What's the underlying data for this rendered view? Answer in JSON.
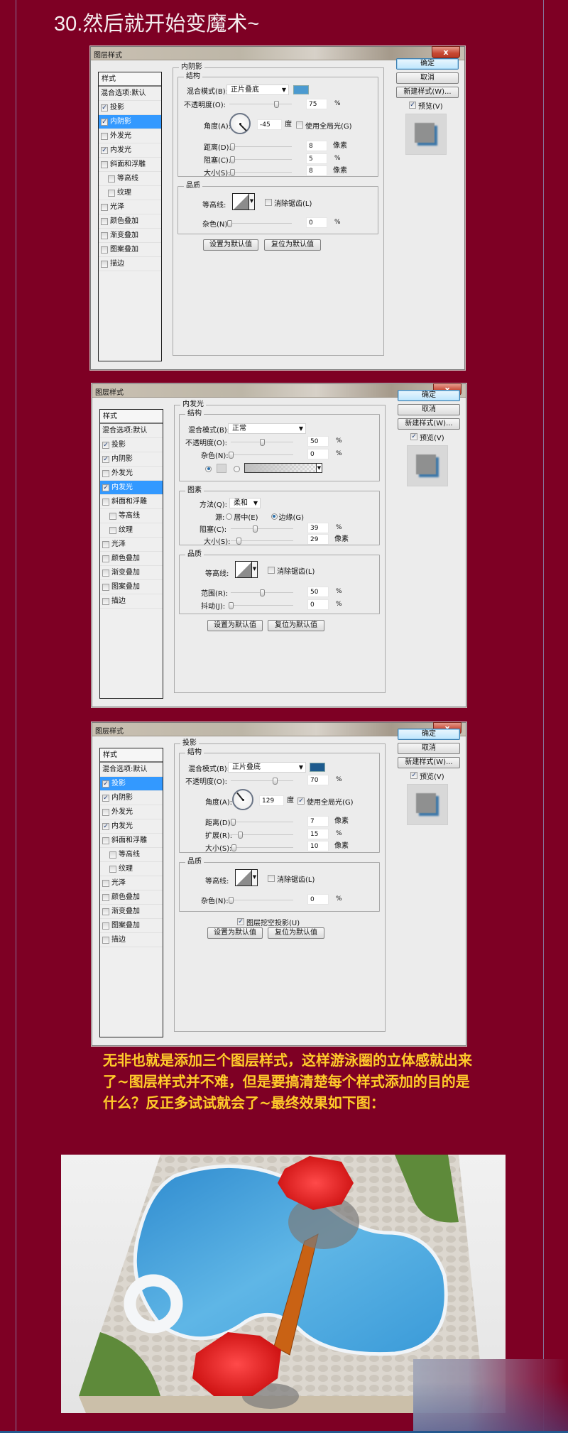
{
  "page": {
    "title": "30.然后就开始变魔术~",
    "note": "无非也就是添加三个图层样式，这样游泳圈的立体感就出来了~图层样式并不难，但是要搞清楚每个样式添加的目的是什么？反正多试试就会了~最终效果如下图：",
    "colors": {
      "background": "#7e0024",
      "note_text": "#ffcb2a",
      "selection": "#3399ff"
    }
  },
  "final_image": {
    "alt": "最终效果：游泳池俯视场景（游泳圈、红色遮阳伞、木桥、草地）"
  },
  "dialog_common": {
    "window_title": "图层样式",
    "close_label": "x",
    "styles_header": "样式",
    "blend_options": "混合选项:默认",
    "ok_label": "确定",
    "cancel_label": "取消",
    "new_style_label": "新建样式(W)...",
    "preview_label": "预览(V)",
    "set_default_label": "设置为默认值",
    "reset_default_label": "复位为默认值",
    "structure_legend": "结构",
    "quality_legend": "品质",
    "elements_legend": "图素",
    "blend_mode_label": "混合模式(B):",
    "opacity_label": "不透明度(O):",
    "angle_label": "角度(A):",
    "degree_unit": "度",
    "global_light_label": "使用全局光(G)",
    "distance_label": "距离(D):",
    "choke_label": "阻塞(C):",
    "spread_label": "扩展(R):",
    "size_label": "大小(S):",
    "contour_label": "等高线:",
    "anti_alias_label": "消除锯齿(L)",
    "noise_label": "杂色(N):",
    "technique_label": "方法(Q):",
    "source_label": "源:",
    "center_label": "居中(E)",
    "edge_label": "边缘(G)",
    "range_label": "范围(R):",
    "jitter_label": "抖动(J):",
    "knockout_label": "图层挖空投影(U)",
    "unit_percent": "%",
    "unit_px": "像素",
    "preview_checked": true
  },
  "dialogs": [
    {
      "section": "内阴影",
      "styles": [
        {
          "label": "投影",
          "checked": true,
          "indent": false,
          "selected": false
        },
        {
          "label": "内阴影",
          "checked": true,
          "indent": false,
          "selected": true
        },
        {
          "label": "外发光",
          "checked": false,
          "indent": false,
          "selected": false
        },
        {
          "label": "内发光",
          "checked": true,
          "indent": false,
          "selected": false
        },
        {
          "label": "斜面和浮雕",
          "checked": false,
          "indent": false,
          "selected": false
        },
        {
          "label": "等高线",
          "checked": false,
          "indent": true,
          "selected": false
        },
        {
          "label": "纹理",
          "checked": false,
          "indent": true,
          "selected": false
        },
        {
          "label": "光泽",
          "checked": false,
          "indent": false,
          "selected": false
        },
        {
          "label": "颜色叠加",
          "checked": false,
          "indent": false,
          "selected": false
        },
        {
          "label": "渐变叠加",
          "checked": false,
          "indent": false,
          "selected": false
        },
        {
          "label": "图案叠加",
          "checked": false,
          "indent": false,
          "selected": false
        },
        {
          "label": "描边",
          "checked": false,
          "indent": false,
          "selected": false
        }
      ],
      "blend_mode": "正片叠底",
      "color": "#4b9ad0",
      "opacity": "75",
      "angle": "-45",
      "use_global_light": false,
      "distance": "8",
      "choke": "5",
      "size": "8",
      "anti_alias": false,
      "noise": "0",
      "slider_fraction": {
        "opacity": 0.75,
        "distance": 0.04,
        "choke": 0.05,
        "size": 0.04,
        "noise": 0
      }
    },
    {
      "section": "内发光",
      "styles": [
        {
          "label": "投影",
          "checked": true,
          "indent": false,
          "selected": false
        },
        {
          "label": "内阴影",
          "checked": true,
          "indent": false,
          "selected": false
        },
        {
          "label": "外发光",
          "checked": false,
          "indent": false,
          "selected": false
        },
        {
          "label": "内发光",
          "checked": true,
          "indent": false,
          "selected": true
        },
        {
          "label": "斜面和浮雕",
          "checked": false,
          "indent": false,
          "selected": false
        },
        {
          "label": "等高线",
          "checked": false,
          "indent": true,
          "selected": false
        },
        {
          "label": "纹理",
          "checked": false,
          "indent": true,
          "selected": false
        },
        {
          "label": "光泽",
          "checked": false,
          "indent": false,
          "selected": false
        },
        {
          "label": "颜色叠加",
          "checked": false,
          "indent": false,
          "selected": false
        },
        {
          "label": "渐变叠加",
          "checked": false,
          "indent": false,
          "selected": false
        },
        {
          "label": "图案叠加",
          "checked": false,
          "indent": false,
          "selected": false
        },
        {
          "label": "描边",
          "checked": false,
          "indent": false,
          "selected": false
        }
      ],
      "blend_mode": "正常",
      "opacity": "50",
      "noise": "0",
      "color_mode": "solid",
      "technique": "柔和",
      "source": "edge",
      "choke": "39",
      "size": "29",
      "anti_alias": false,
      "range": "50",
      "jitter": "0",
      "slider_fraction": {
        "opacity": 0.5,
        "noise": 0,
        "choke": 0.39,
        "size": 0.12,
        "range": 0.5,
        "jitter": 0
      }
    },
    {
      "section": "投影",
      "styles": [
        {
          "label": "投影",
          "checked": true,
          "indent": false,
          "selected": true
        },
        {
          "label": "内阴影",
          "checked": true,
          "indent": false,
          "selected": false
        },
        {
          "label": "外发光",
          "checked": false,
          "indent": false,
          "selected": false
        },
        {
          "label": "内发光",
          "checked": true,
          "indent": false,
          "selected": false
        },
        {
          "label": "斜面和浮雕",
          "checked": false,
          "indent": false,
          "selected": false
        },
        {
          "label": "等高线",
          "checked": false,
          "indent": true,
          "selected": false
        },
        {
          "label": "纹理",
          "checked": false,
          "indent": true,
          "selected": false
        },
        {
          "label": "光泽",
          "checked": false,
          "indent": false,
          "selected": false
        },
        {
          "label": "颜色叠加",
          "checked": false,
          "indent": false,
          "selected": false
        },
        {
          "label": "渐变叠加",
          "checked": false,
          "indent": false,
          "selected": false
        },
        {
          "label": "图案叠加",
          "checked": false,
          "indent": false,
          "selected": false
        },
        {
          "label": "描边",
          "checked": false,
          "indent": false,
          "selected": false
        }
      ],
      "blend_mode": "正片叠底",
      "color": "#1d5a8e",
      "opacity": "70",
      "angle": "129",
      "use_global_light": true,
      "distance": "7",
      "spread": "15",
      "size": "10",
      "anti_alias": false,
      "noise": "0",
      "knockout": true,
      "slider_fraction": {
        "opacity": 0.7,
        "distance": 0.035,
        "spread": 0.15,
        "size": 0.05,
        "noise": 0
      }
    }
  ]
}
